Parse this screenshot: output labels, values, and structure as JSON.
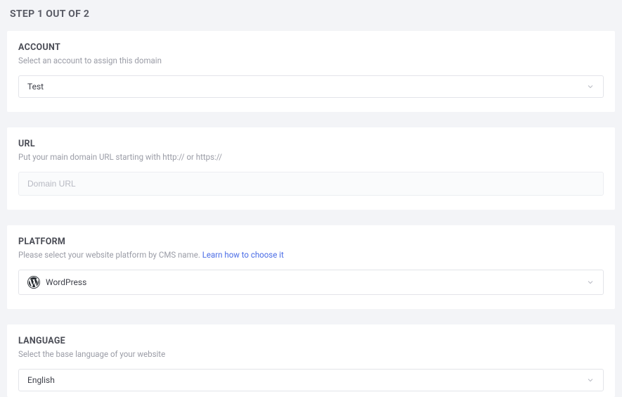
{
  "page": {
    "title": "STEP 1 OUT OF 2"
  },
  "account": {
    "title": "ACCOUNT",
    "sub": "Select an account to assign this domain",
    "value": "Test"
  },
  "url": {
    "title": "URL",
    "sub": "Put your main domain URL starting with http:// or https://",
    "placeholder": "Domain URL"
  },
  "platform": {
    "title": "PLATFORM",
    "sub_prefix": "Please select your website platform by CMS name. ",
    "link": "Learn how to choose it",
    "value": "WordPress"
  },
  "language": {
    "title": "LANGUAGE",
    "sub": "Select the base language of your website",
    "value": "English"
  }
}
